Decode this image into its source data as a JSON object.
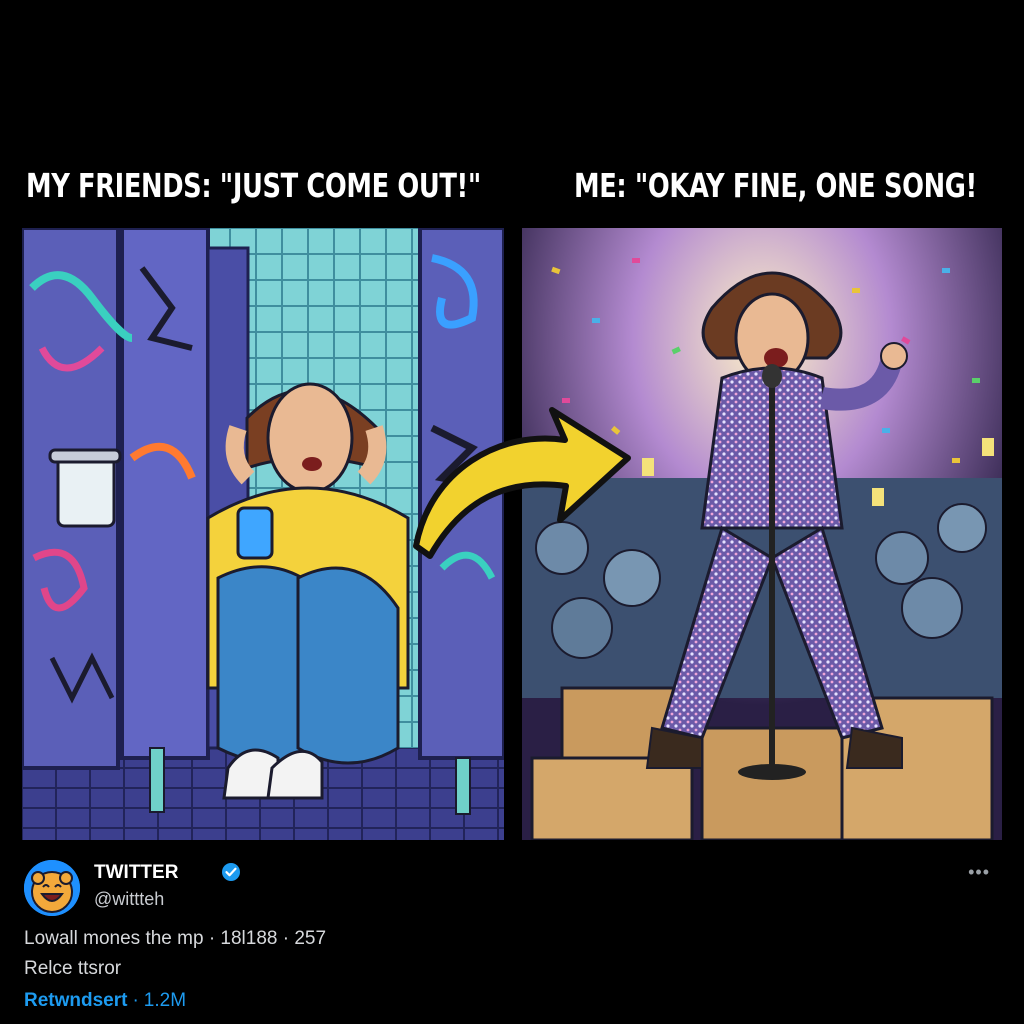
{
  "captions": {
    "left": "MY FRIENDS: \"JUST COME OUT!\"",
    "right": "ME: \"OKAY FINE, ONE SONG!"
  },
  "post": {
    "account_name": "TWITTER",
    "handle": "@wittteh",
    "line1": "Lowall mones the mp · 18l188 · 257",
    "line2": "Relce ttsror",
    "retweet_label": "Retwndsert",
    "retweet_separator": "·",
    "retweet_count": "1.2M",
    "more_label": "•••"
  },
  "colors": {
    "background": "#000000",
    "link_blue": "#1d9bf0",
    "arrow_yellow": "#f2d22e",
    "stall_purple": "#5b5fb8"
  }
}
